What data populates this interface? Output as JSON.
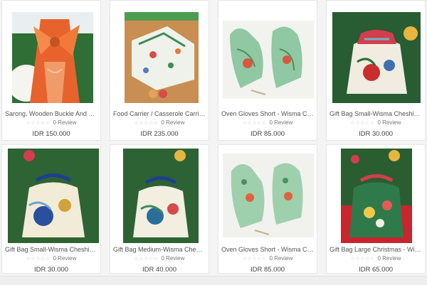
{
  "products": [
    {
      "title": "Sarong, Wooden Buckle And Mas...",
      "reviews": "0 Review",
      "price": "IDR 150.000",
      "image_icon": "sarong-orange-photo"
    },
    {
      "title": "Food Carrier / Casserole Carrier-...",
      "reviews": "0 Review",
      "price": "IDR 235.000",
      "image_icon": "food-carrier-photo"
    },
    {
      "title": "Oven Gloves Short - Wisma Cheshi...",
      "reviews": "0 Review",
      "price": "IDR 85.000",
      "image_icon": "oven-gloves-photo"
    },
    {
      "title": "Gift Bag Small-Wisma Cheshire - ...",
      "reviews": "0 Review",
      "price": "IDR 30.000",
      "image_icon": "gift-bag-photo"
    },
    {
      "title": "Gift Bag Small-Wisma Cheshire - ...",
      "reviews": "0 Review",
      "price": "IDR 30.000",
      "image_icon": "gift-bag-photo"
    },
    {
      "title": "Gift Bag Medium-Wisma Cheshire...",
      "reviews": "0 Review",
      "price": "IDR 40.000",
      "image_icon": "gift-bag-photo"
    },
    {
      "title": "Oven Gloves Short - Wisma Chesh...",
      "reviews": "0 Review",
      "price": "IDR 85.000",
      "image_icon": "oven-gloves-photo"
    },
    {
      "title": "Gift Bag Large Christmas - Wisma ...",
      "reviews": "0 Review",
      "price": "IDR 65.000",
      "image_icon": "gift-bag-red-photo"
    }
  ],
  "rating_stars": "☆☆☆☆☆",
  "colors": {
    "background": "#f4f4f4",
    "card": "#ffffff",
    "text": "#555555",
    "star": "#c8c8c8"
  }
}
